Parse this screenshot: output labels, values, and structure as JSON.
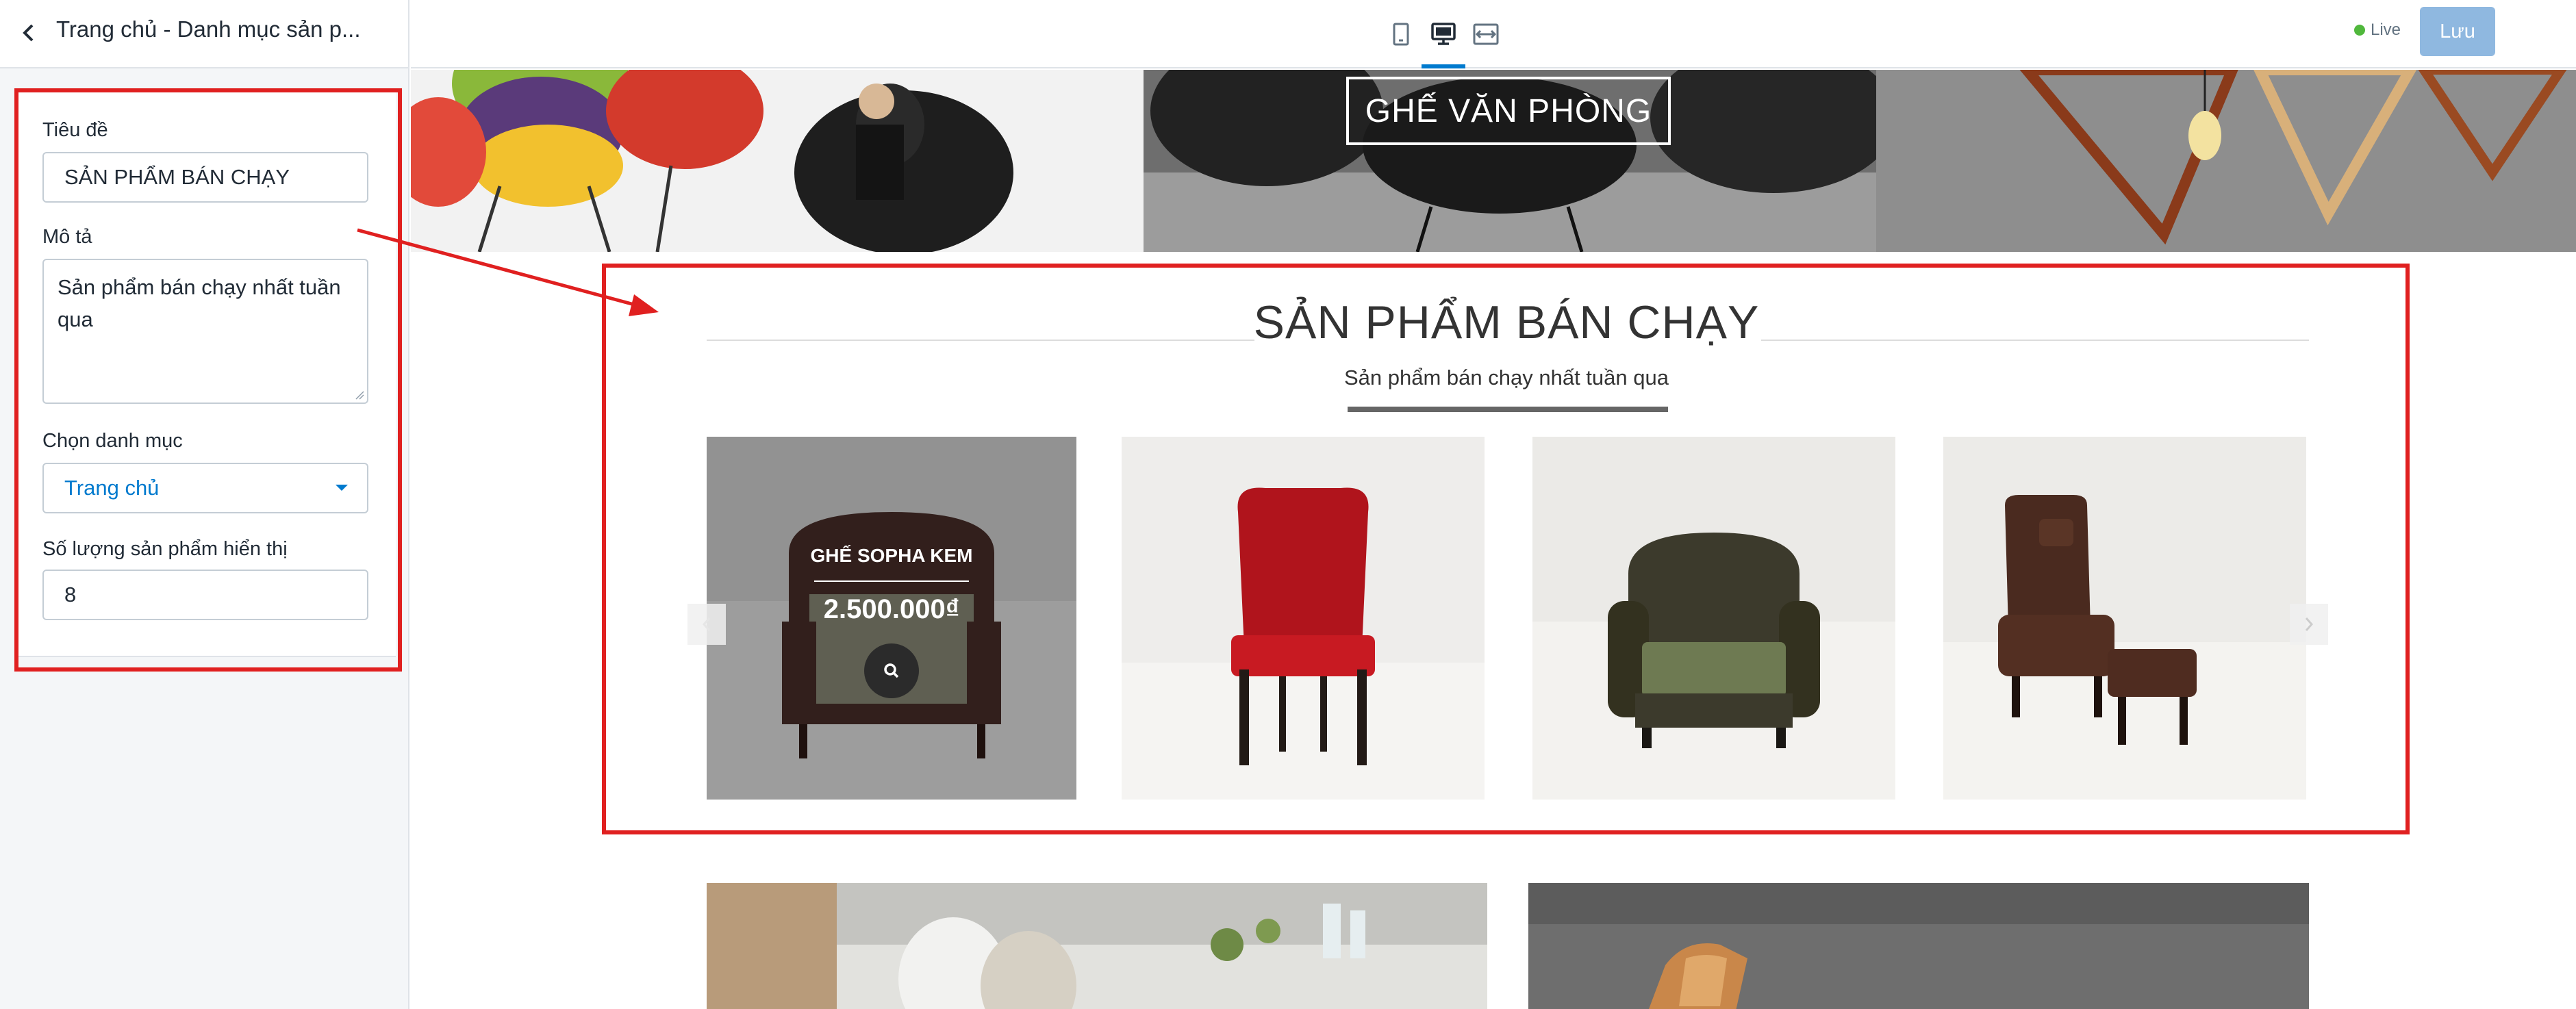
{
  "sidebar": {
    "title": "Trang chủ - Danh mục sản p...",
    "fields": {
      "title_label": "Tiêu đề",
      "title_value": "SẢN PHẨM BÁN CHẠY",
      "desc_label": "Mô tả",
      "desc_value": "Sản phẩm bán chạy nhất tuần qua",
      "category_label": "Chọn danh mục",
      "category_value": "Trang chủ",
      "count_label": "Số lượng sản phẩm hiển thị",
      "count_value": "8"
    }
  },
  "topbar": {
    "devices": [
      "mobile-icon",
      "desktop-icon",
      "fullwidth-icon"
    ],
    "active_device": "desktop",
    "live_label": "Live",
    "save_label": "Lưu"
  },
  "preview": {
    "banner_button": "GHẾ VĂN PHÒNG",
    "section_title": "SẢN PHẨM BÁN CHẠY",
    "section_subtitle": "Sản phẩm bán chạy nhất tuần qua",
    "products": [
      {
        "name": "GHẾ SOPHA KEM",
        "price": "2.500.000₫",
        "hovered": true
      },
      {
        "name": "",
        "price": "",
        "hovered": false
      },
      {
        "name": "",
        "price": "",
        "hovered": false
      },
      {
        "name": "",
        "price": "",
        "hovered": false
      }
    ]
  },
  "colors": {
    "accent": "#007ace",
    "annotation": "#e02020",
    "save_button": "#8fb8e0",
    "live_dot": "#50b83c"
  }
}
